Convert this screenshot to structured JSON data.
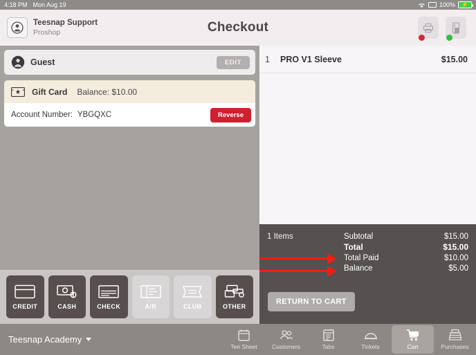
{
  "statusbar": {
    "time": "4:18 PM",
    "date": "Mon Aug 19",
    "wifi_icon": "wifi-icon",
    "screen_icon": "airplay-icon",
    "battery_percent": "100%",
    "battery_icon": "battery-charging-icon"
  },
  "header": {
    "avatar_icon": "user-avatar-icon",
    "account_name": "Teesnap Support",
    "account_role": "Proshop",
    "title": "Checkout",
    "printer_icon": "printer-icon",
    "printer_status_color": "#d1283a",
    "card_reader_icon": "card-reader-icon",
    "card_reader_status_color": "#2fc23c"
  },
  "customer": {
    "avatar_icon": "guest-avatar-icon",
    "name": "Guest",
    "edit_label": "EDIT"
  },
  "payment_applied": {
    "icon": "gift-card-icon",
    "type": "Gift Card",
    "balance_label": "Balance: $10.00",
    "account_label": "Account Number:",
    "account_number": "YBGQXC",
    "reverse_label": "Reverse",
    "reverse_color": "#d0202f"
  },
  "payment_methods": [
    {
      "label": "CREDIT",
      "icon": "credit-card-icon",
      "enabled": true
    },
    {
      "label": "CASH",
      "icon": "cash-icon",
      "enabled": true
    },
    {
      "label": "CHECK",
      "icon": "check-icon",
      "enabled": true
    },
    {
      "label": "A/R",
      "icon": "ar-ticket-icon",
      "enabled": false
    },
    {
      "label": "CLUB",
      "icon": "club-ticket-icon",
      "enabled": false
    },
    {
      "label": "OTHER",
      "icon": "other-cards-icon",
      "enabled": true
    }
  ],
  "cart": {
    "items": [
      {
        "qty": "1",
        "name": "PRO V1 Sleeve",
        "price": "$15.00"
      }
    ],
    "items_count_label": "1 Items",
    "totals": [
      {
        "label": "Subtotal",
        "value": "$15.00",
        "strong": false
      },
      {
        "label": "Total",
        "value": "$15.00",
        "strong": true
      },
      {
        "label": "Total Paid",
        "value": "$10.00",
        "strong": false
      },
      {
        "label": "Balance",
        "value": "$5.00",
        "strong": false
      }
    ],
    "return_label": "RETURN TO CART"
  },
  "annotations": {
    "color": "#fb1b0c",
    "arrows": [
      {
        "target": "Total Paid"
      },
      {
        "target": "Balance"
      }
    ]
  },
  "bottom": {
    "brand": "Teesnap Academy",
    "caret_icon": "chevron-down-icon",
    "tabs": [
      {
        "label": "Tee Sheet",
        "icon": "calendar-icon",
        "active": false
      },
      {
        "label": "Customers",
        "icon": "people-icon",
        "active": false
      },
      {
        "label": "Tabs",
        "icon": "tabs-icon",
        "active": false
      },
      {
        "label": "Tickets",
        "icon": "cloche-icon",
        "active": false
      },
      {
        "label": "Cart",
        "icon": "cart-icon",
        "active": true
      },
      {
        "label": "Purchases",
        "icon": "register-icon",
        "active": false
      }
    ]
  }
}
